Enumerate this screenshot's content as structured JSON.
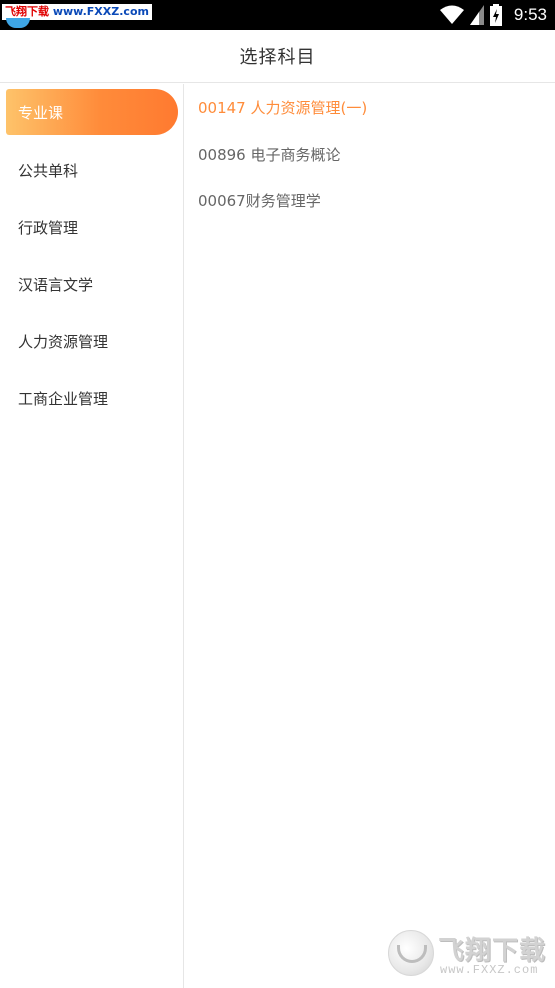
{
  "status_bar": {
    "time": "9:53",
    "watermark_text_a": "飞翔下载",
    "watermark_text_b": " www.FXXZ.com",
    "icons": [
      "wifi-icon",
      "signal-icon",
      "battery-charging-icon"
    ]
  },
  "header": {
    "title": "选择科目"
  },
  "sidebar": {
    "items": [
      {
        "label": "专业课",
        "active": true
      },
      {
        "label": "公共单科",
        "active": false
      },
      {
        "label": "行政管理",
        "active": false
      },
      {
        "label": "汉语言文学",
        "active": false
      },
      {
        "label": "人力资源管理",
        "active": false
      },
      {
        "label": "工商企业管理",
        "active": false
      }
    ]
  },
  "subjects": [
    {
      "label": "00147 人力资源管理(一)",
      "active": true
    },
    {
      "label": "00896 电子商务概论",
      "active": false
    },
    {
      "label": "00067财务管理学",
      "active": false
    }
  ],
  "watermark": {
    "brand": "飞翔下载",
    "url": "www.FXXZ.com"
  },
  "colors": {
    "accent": "#ff8c3a",
    "accent_light": "#fec36a",
    "text": "#333333",
    "muted": "#666666"
  }
}
